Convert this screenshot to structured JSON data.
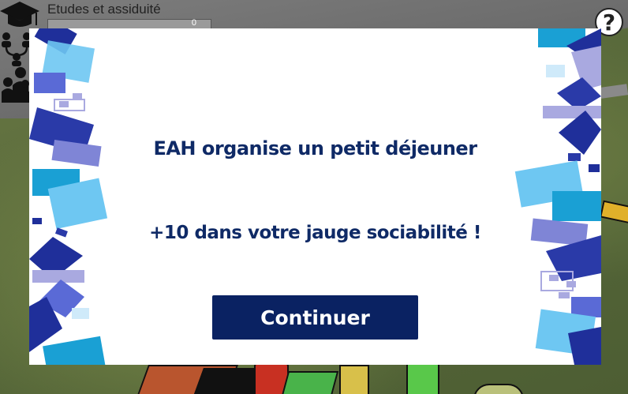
{
  "hud": {
    "studies_label": "Etudes et assiduité",
    "studies_value": "0",
    "help_symbol": "?"
  },
  "icons": {
    "studies": "graduation-cap-icon",
    "network": "organization-chart-icon",
    "social": "people-group-icon",
    "help": "question-mark-icon"
  },
  "dialog": {
    "title": "EAH organise un petit déjeuner",
    "message": "+10 dans votre jauge sociabilité !",
    "continue_label": "Continuer"
  },
  "colors": {
    "text_primary": "#0f2a66",
    "button_bg": "#0a2262",
    "deco_dark_blue": "#1f2f9a",
    "deco_mid_blue": "#5a6ad6",
    "deco_light_blue": "#6ec7f2",
    "deco_teal": "#1aa0d4",
    "deco_lavender": "#a9a9e0"
  }
}
